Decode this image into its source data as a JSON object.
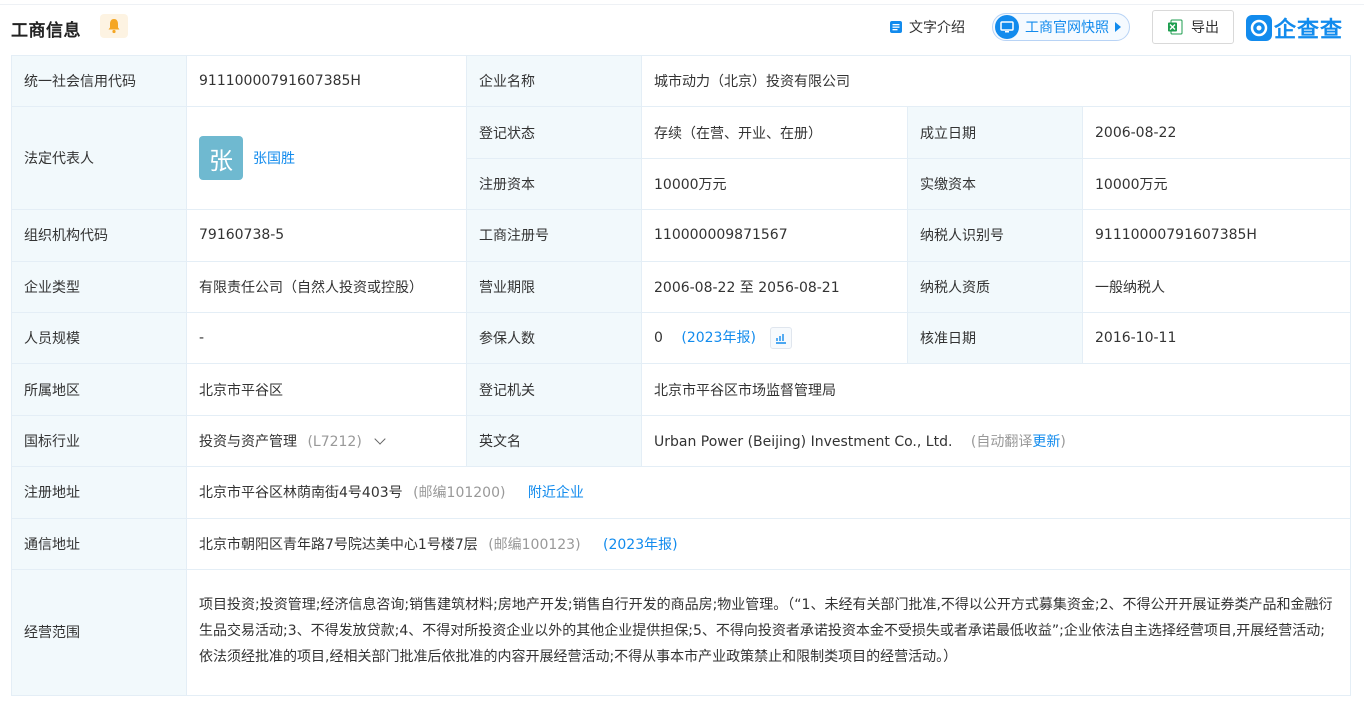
{
  "header": {
    "title": "工商信息",
    "text_intro_label": "文字介绍",
    "snapshot_label": "工商官网快照",
    "export_label": "导出",
    "logo_text": "企查查"
  },
  "colors": {
    "accent": "#128bed",
    "label_bg": "#f2f9fc",
    "border": "#e4eef6",
    "avatar": "#6fb9d0",
    "bell": "#f5a623"
  },
  "fields": {
    "credit_code_label": "统一社会信用代码",
    "credit_code": "91110000791607385H",
    "company_name_label": "企业名称",
    "company_name": "城市动力（北京）投资有限公司",
    "legal_rep_label": "法定代表人",
    "legal_rep_avatar": "张",
    "legal_rep": "张国胜",
    "reg_status_label": "登记状态",
    "reg_status": "存续（在营、开业、在册）",
    "founded_label": "成立日期",
    "founded": "2006-08-22",
    "reg_capital_label": "注册资本",
    "reg_capital": "10000万元",
    "paid_capital_label": "实缴资本",
    "paid_capital": "10000万元",
    "org_code_label": "组织机构代码",
    "org_code": "79160738-5",
    "biz_reg_no_label": "工商注册号",
    "biz_reg_no": "110000009871567",
    "taxpayer_id_label": "纳税人识别号",
    "taxpayer_id": "91110000791607385H",
    "company_type_label": "企业类型",
    "company_type": "有限责任公司（自然人投资或控股）",
    "biz_term_label": "营业期限",
    "biz_term": "2006-08-22 至 2056-08-21",
    "taxpayer_qual_label": "纳税人资质",
    "taxpayer_qual": "一般纳税人",
    "staff_size_label": "人员规模",
    "staff_size": "-",
    "insured_label": "参保人数",
    "insured": "0",
    "insured_report": "(2023年报)",
    "approval_date_label": "核准日期",
    "approval_date": "2016-10-11",
    "region_label": "所属地区",
    "region": "北京市平谷区",
    "reg_authority_label": "登记机关",
    "reg_authority": "北京市平谷区市场监督管理局",
    "industry_label": "国标行业",
    "industry": "投资与资产管理",
    "industry_code": "(L7212)",
    "english_name_label": "英文名",
    "english_name": "Urban Power (Beijing) Investment Co., Ltd.",
    "auto_translate": "(自动翻译",
    "update_link": "更新",
    "close_paren": ")",
    "reg_address_label": "注册地址",
    "reg_address": "北京市平谷区林荫南街4号403号",
    "reg_postcode": "(邮编101200)",
    "nearby_link": "附近企业",
    "mail_address_label": "通信地址",
    "mail_address": "北京市朝阳区青年路7号院达美中心1号楼7层",
    "mail_postcode": "(邮编100123)",
    "mail_report": "(2023年报)",
    "scope_label": "经营范围",
    "scope": "项目投资;投资管理;经济信息咨询;销售建筑材料;房地产开发;销售自行开发的商品房;物业管理。（“1、未经有关部门批准,不得以公开方式募集资金;2、不得公开开展证券类产品和金融衍生品交易活动;3、不得发放贷款;4、不得对所投资企业以外的其他企业提供担保;5、不得向投资者承诺投资本金不受损失或者承诺最低收益”;企业依法自主选择经营项目,开展经营活动;依法须经批准的项目,经相关部门批准后依批准的内容开展经营活动;不得从事本市产业政策禁止和限制类项目的经营活动。）"
  }
}
